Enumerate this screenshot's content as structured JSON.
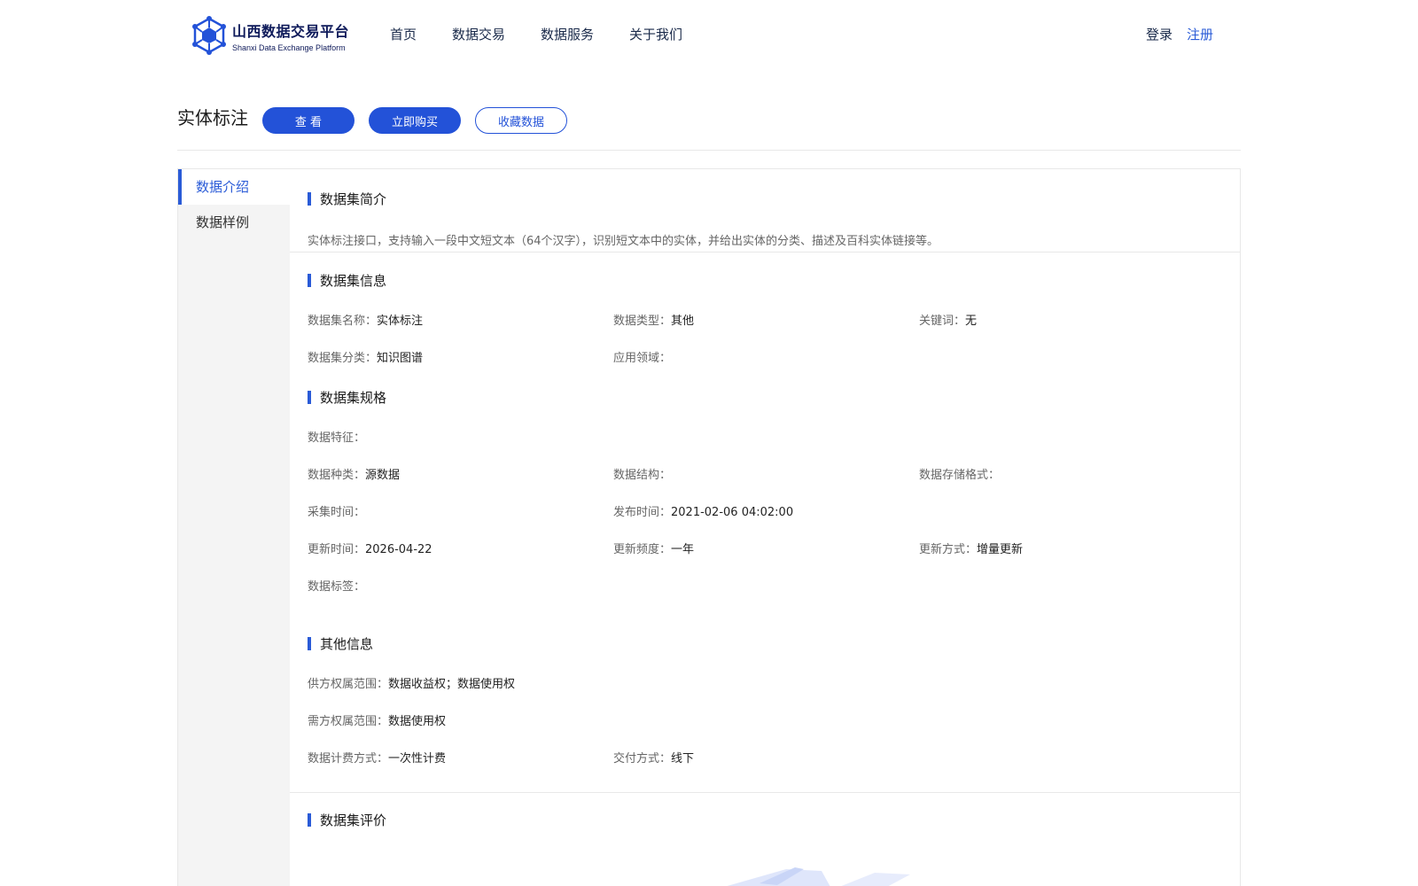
{
  "brand": {
    "name_cn": "山西数据交易平台",
    "name_en": "Shanxi Data Exchange Platform"
  },
  "nav": [
    "首页",
    "数据交易",
    "数据服务",
    "关于我们"
  ],
  "auth": {
    "login": "登录",
    "register": "注册"
  },
  "page": {
    "title": "实体标注",
    "buttons": {
      "view": "查 看",
      "buy": "立即购买",
      "favorite": "收藏数据"
    }
  },
  "sidebar": {
    "items": [
      "数据介绍",
      "数据样例"
    ]
  },
  "sections": {
    "intro": {
      "title": "数据集简介",
      "text": "实体标注接口，支持输入一段中文短文本（64个汉字），识别短文本中的实体，并给出实体的分类、描述及百科实体链接等。"
    },
    "info": {
      "title": "数据集信息",
      "name_label": "数据集名称：",
      "name_value": "实体标注",
      "type_label": "数据类型：",
      "type_value": "其他",
      "keyword_label": "关键词：",
      "keyword_value": "无",
      "category_label": "数据集分类：",
      "category_value": "知识图谱",
      "domain_label": "应用领域：",
      "domain_value": ""
    },
    "spec": {
      "title": "数据集规格",
      "feature_label": "数据特征：",
      "feature_value": "",
      "kind_label": "数据种类：",
      "kind_value": "源数据",
      "structure_label": "数据结构：",
      "structure_value": "",
      "storage_label": "数据存储格式：",
      "storage_value": "",
      "collect_label": "采集时间：",
      "collect_value": "",
      "publish_label": "发布时间：",
      "publish_value": "2021-02-06 04:02:00",
      "update_label": "更新时间：",
      "update_value": "2026-04-22",
      "freq_label": "更新频度：",
      "freq_value": "一年",
      "mode_label": "更新方式：",
      "mode_value": "增量更新",
      "tag_label": "数据标签：",
      "tag_value": ""
    },
    "other": {
      "title": "其他信息",
      "supplier_label": "供方权属范围：",
      "supplier_value": "数据收益权；数据使用权",
      "demander_label": "需方权属范围：",
      "demander_value": "数据使用权",
      "billing_label": "数据计费方式：",
      "billing_value": "一次性计费",
      "delivery_label": "交付方式：",
      "delivery_value": "线下"
    },
    "review": {
      "title": "数据集评价"
    }
  },
  "colors": {
    "primary": "#2352d8",
    "accent_text": "#2a5bd7",
    "brand_dark": "#0e1a5a"
  }
}
